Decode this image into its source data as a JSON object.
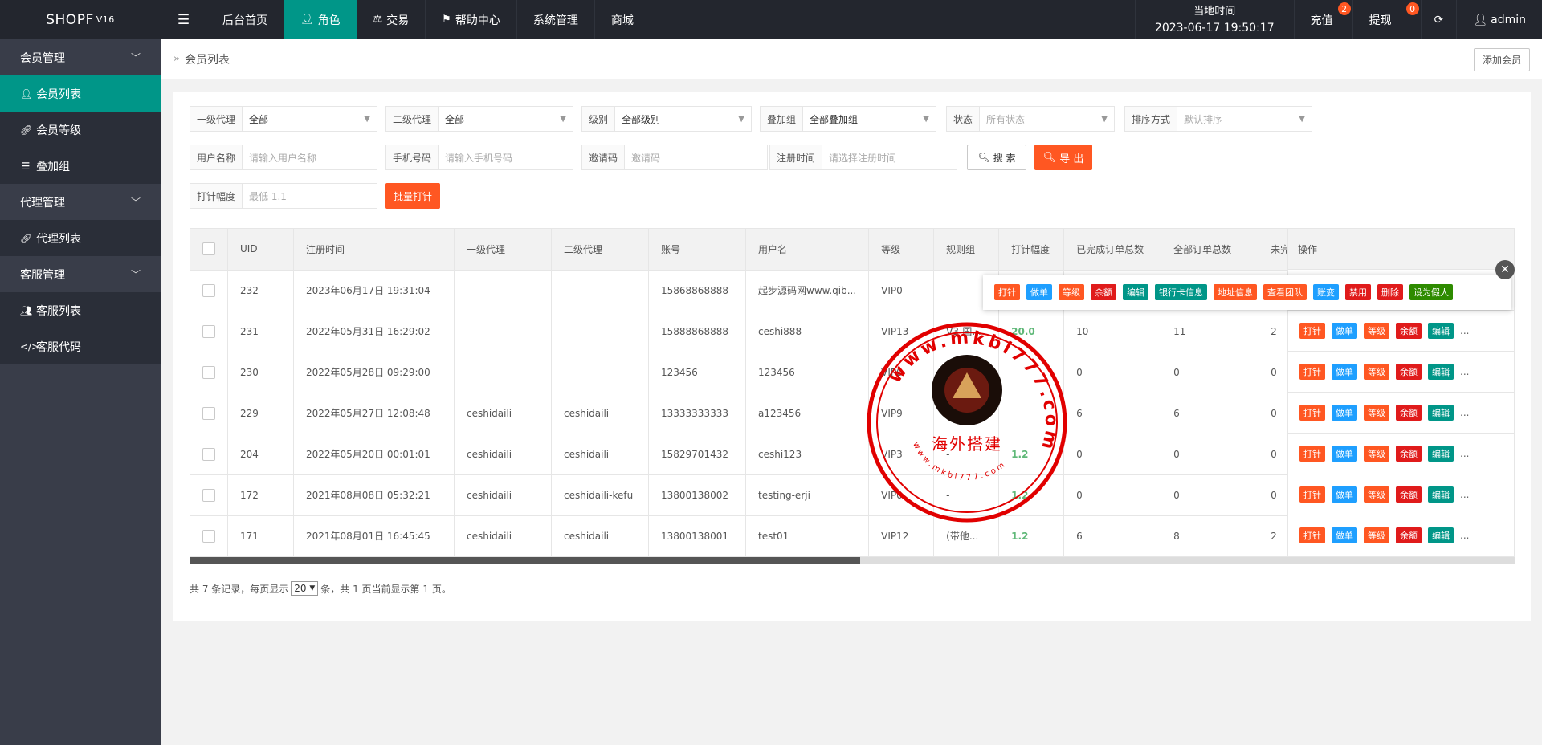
{
  "header": {
    "logo": "SHOPF",
    "version": "V16",
    "nav": [
      {
        "label": "后台首页"
      },
      {
        "label": "角色"
      },
      {
        "label": "交易"
      },
      {
        "label": "帮助中心"
      },
      {
        "label": "系统管理"
      },
      {
        "label": "商城"
      }
    ],
    "time_label": "当地时间",
    "time_value": "2023-06-17 19:50:17",
    "recharge": "充值",
    "recharge_badge": "2",
    "withdraw": "提现",
    "withdraw_badge": "0",
    "user": "admin"
  },
  "sidebar": {
    "groups": [
      {
        "label": "会员管理",
        "items": [
          "会员列表",
          "会员等级",
          "叠加组"
        ]
      },
      {
        "label": "代理管理",
        "items": [
          "代理列表"
        ]
      },
      {
        "label": "客服管理",
        "items": [
          "客服列表",
          "客服代码"
        ]
      }
    ]
  },
  "breadcrumb": {
    "current": "会员列表",
    "add_button": "添加会员"
  },
  "filters": {
    "agent1": {
      "label": "一级代理",
      "value": "全部"
    },
    "agent2": {
      "label": "二级代理",
      "value": "全部"
    },
    "level": {
      "label": "级别",
      "value": "全部级别"
    },
    "group": {
      "label": "叠加组",
      "value": "全部叠加组"
    },
    "status": {
      "label": "状态",
      "placeholder": "所有状态"
    },
    "sort": {
      "label": "排序方式",
      "placeholder": "默认排序"
    },
    "username": {
      "label": "用户名称",
      "placeholder": "请输入用户名称"
    },
    "phone": {
      "label": "手机号码",
      "placeholder": "请输入手机号码"
    },
    "invite": {
      "label": "邀请码",
      "placeholder": "邀请码"
    },
    "regtime": {
      "label": "注册时间",
      "placeholder": "请选择注册时间"
    },
    "search_button": "搜 索",
    "export_button": "导 出",
    "range": {
      "label": "打针幅度",
      "placeholder": "最低 1.1"
    },
    "batch_button": "批量打针"
  },
  "table": {
    "columns": [
      "UID",
      "注册时间",
      "一级代理",
      "二级代理",
      "账号",
      "用户名",
      "等级",
      "规则组",
      "打针幅度",
      "已完成订单总数",
      "全部订单总数",
      "未完成"
    ],
    "op_header": "操作",
    "rows": [
      {
        "uid": "232",
        "time": "2023年06月17日 19:31:04",
        "a1": "",
        "a2": "",
        "account": "15868868888",
        "name": "起步源码网www.qib...",
        "level": "VIP0",
        "rule": "-",
        "range": "",
        "done": "",
        "total": "",
        "undone": ""
      },
      {
        "uid": "231",
        "time": "2022年05月31日 16:29:02",
        "a1": "",
        "a2": "",
        "account": "15888868888",
        "name": "ceshi888",
        "level": "VIP13",
        "rule": "V3-国...",
        "range": "20.0",
        "done": "10",
        "total": "11",
        "undone": "2"
      },
      {
        "uid": "230",
        "time": "2022年05月28日 09:29:00",
        "a1": "",
        "a2": "",
        "account": "123456",
        "name": "123456",
        "level": "VIP0",
        "rule": "-",
        "range": "",
        "done": "0",
        "total": "0",
        "undone": "0"
      },
      {
        "uid": "229",
        "time": "2022年05月27日 12:08:48",
        "a1": "ceshidaili",
        "a2": "ceshidaili",
        "account": "13333333333",
        "name": "a123456",
        "level": "VIP9",
        "rule": "",
        "range": "",
        "done": "6",
        "total": "6",
        "undone": "0"
      },
      {
        "uid": "204",
        "time": "2022年05月20日 00:01:01",
        "a1": "ceshidaili",
        "a2": "ceshidaili",
        "account": "15829701432",
        "name": "ceshi123",
        "level": "VIP3",
        "rule": "-",
        "range": "1.2",
        "done": "0",
        "total": "0",
        "undone": "0"
      },
      {
        "uid": "172",
        "time": "2021年08月08日 05:32:21",
        "a1": "ceshidaili",
        "a2": "ceshidaili-kefu",
        "account": "13800138002",
        "name": "testing-erji",
        "level": "VIP0",
        "rule": "-",
        "range": "1.2",
        "done": "0",
        "total": "0",
        "undone": "0"
      },
      {
        "uid": "171",
        "time": "2021年08月01日 16:45:45",
        "a1": "ceshidaili",
        "a2": "ceshidaili",
        "account": "13800138001",
        "name": "test01",
        "level": "VIP12",
        "rule": "(带他...",
        "range": "1.2",
        "done": "6",
        "total": "8",
        "undone": "2"
      }
    ],
    "row_actions": [
      "打针",
      "做单",
      "等级",
      "余额",
      "编辑"
    ],
    "more": "...",
    "popup_actions": [
      "打针",
      "做单",
      "等级",
      "余额",
      "编辑",
      "银行卡信息",
      "地址信息",
      "查看团队",
      "账变",
      "禁用",
      "删除",
      "设为假人"
    ]
  },
  "pager": {
    "prefix": "共 7 条记录，每页显示",
    "page_size": "20",
    "suffix": "条，共 1 页当前显示第 1 页。"
  },
  "stamp": {
    "ring_text": "www.mkbl777.com",
    "center_text": "海外搭建",
    "inner_text": "www.mkbl777.com"
  },
  "colors": {
    "header_bg": "#23262e",
    "sidebar_bg": "#393d49",
    "accent": "#009688",
    "orange": "#ff5722",
    "blue": "#1e9fff",
    "red": "#e01b1b"
  }
}
